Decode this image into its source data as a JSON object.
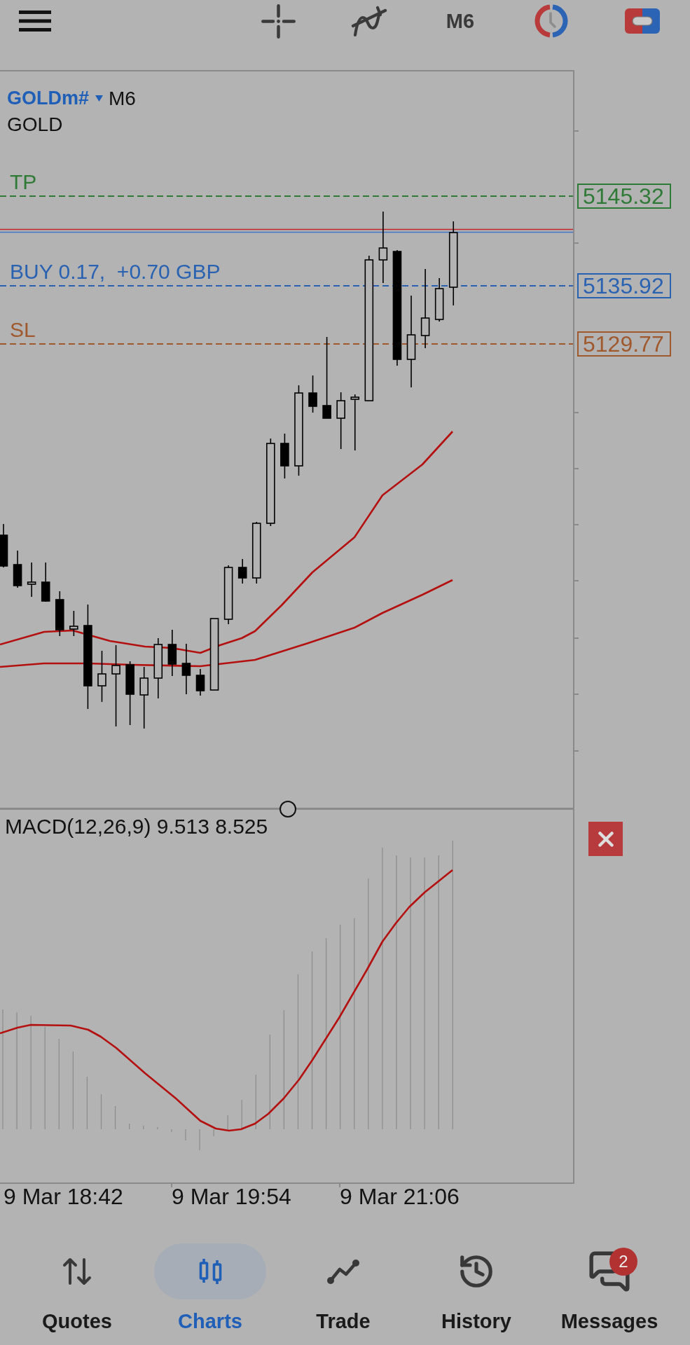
{
  "toolbar": {
    "timeframe": "M6"
  },
  "chart": {
    "symbol": "GOLDm#",
    "timeframe": "M6",
    "description": "GOLD",
    "levels": [
      {
        "label": "TP",
        "price": "5145.32",
        "color": "#2f7a37"
      },
      {
        "label": "BUY 0.17,  +0.70 GBP",
        "price": "5135.92",
        "color": "#2a62b2"
      },
      {
        "label": "SL",
        "price": "5129.77",
        "color": "#a0582d"
      }
    ]
  },
  "indicator": {
    "label": "MACD(12,26,9) 9.513 8.525"
  },
  "time_axis": {
    "labels": [
      "9 Mar 18:42",
      "9 Mar 19:54",
      "9 Mar 21:06"
    ]
  },
  "nav": {
    "items": [
      {
        "label": "Quotes",
        "selected": false
      },
      {
        "label": "Charts",
        "selected": true
      },
      {
        "label": "Trade",
        "selected": false
      },
      {
        "label": "History",
        "selected": false
      },
      {
        "label": "Messages",
        "selected": false,
        "badge": "2"
      }
    ]
  }
}
